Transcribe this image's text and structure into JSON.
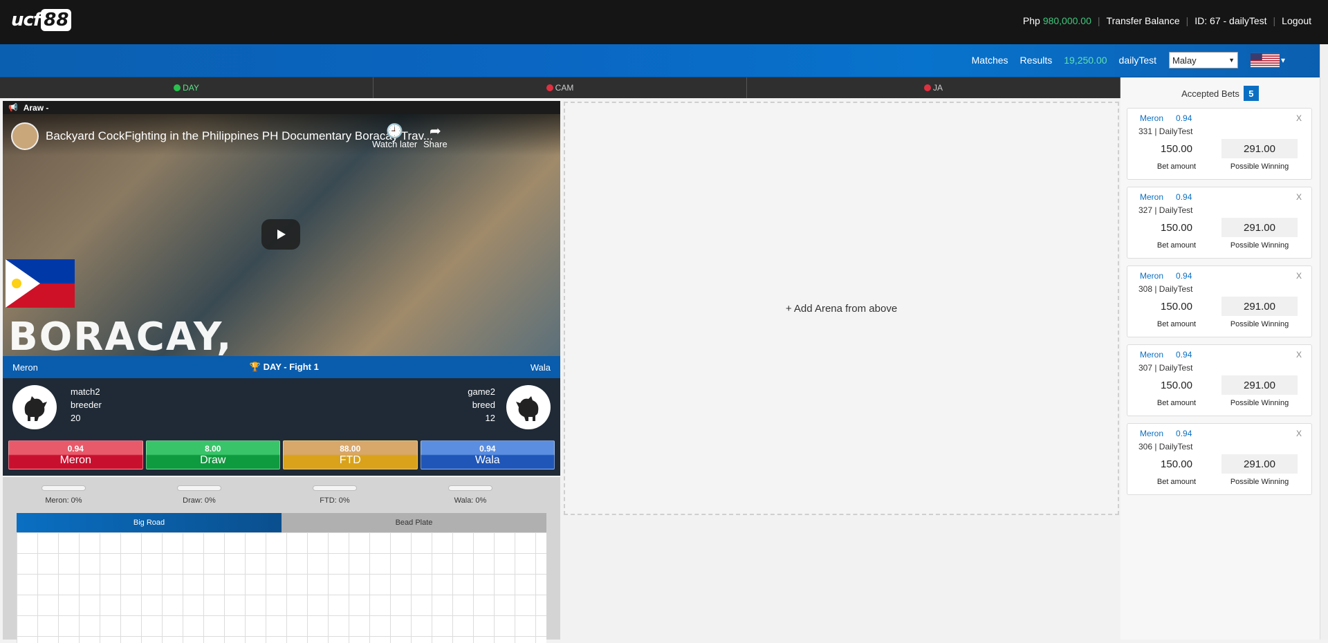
{
  "brand": {
    "logo_left": "ucf",
    "logo_right": "88"
  },
  "account": {
    "currency": "Php",
    "balance": "980,000.00",
    "transfer_label": "Transfer Balance",
    "id_label": "ID: 67 - dailyTest",
    "logout_label": "Logout"
  },
  "subnav": {
    "matches": "Matches",
    "results": "Results",
    "balance": "19,250.00",
    "username": "dailyTest",
    "language": "Malay",
    "language_arrow": "▼",
    "flag_arrow": "▾"
  },
  "tabs": [
    {
      "label": "DAY",
      "dot_color": "#27c24c"
    },
    {
      "label": "CAM",
      "dot_color": "#e03040"
    },
    {
      "label": "JA",
      "dot_color": "#e03040"
    }
  ],
  "arena": {
    "title": "Araw -",
    "video_title": "Backyard CockFighting in the Philippines PH Documentary Boracay Trav...",
    "watch_later": "Watch later",
    "share": "Share",
    "watermark": "BORACAY,",
    "left_label": "Meron",
    "fight_title": "DAY - Fight 1",
    "right_label": "Wala",
    "left_fighter": {
      "name": "match2",
      "breed": "breeder",
      "weight": "20"
    },
    "right_fighter": {
      "name": "game2",
      "breed": "breed",
      "weight": "12"
    }
  },
  "bets": [
    {
      "odd": "0.94",
      "label": "Meron",
      "color_top": "#e85a6a",
      "color_bottom": "#c8102e"
    },
    {
      "odd": "8.00",
      "label": "Draw",
      "color_top": "#39c46a",
      "color_bottom": "#0e9a3e"
    },
    {
      "odd": "88.00",
      "label": "FTD",
      "color_top": "#d8a76a",
      "color_bottom": "#d9a21a"
    },
    {
      "odd": "0.94",
      "label": "Wala",
      "color_top": "#5b8ee0",
      "color_bottom": "#1f56b8"
    }
  ],
  "stats": [
    {
      "label": "Meron: 0%",
      "pct": 0
    },
    {
      "label": "Draw: 0%",
      "pct": 0
    },
    {
      "label": "FTD: 0%",
      "pct": 0
    },
    {
      "label": "Wala: 0%",
      "pct": 0
    }
  ],
  "road_tabs": {
    "big_road": "Big Road",
    "bead_plate": "Bead Plate"
  },
  "add_arena": "+ Add Arena from above",
  "accepted": {
    "title": "Accepted Bets",
    "count": "5",
    "bet_amount_label": "Bet amount",
    "possible_label": "Possible Winning",
    "items": [
      {
        "side": "Meron",
        "odd": "0.94",
        "ref": "331 | DailyTest",
        "amount": "150.00",
        "win": "291.00"
      },
      {
        "side": "Meron",
        "odd": "0.94",
        "ref": "327 | DailyTest",
        "amount": "150.00",
        "win": "291.00"
      },
      {
        "side": "Meron",
        "odd": "0.94",
        "ref": "308 | DailyTest",
        "amount": "150.00",
        "win": "291.00"
      },
      {
        "side": "Meron",
        "odd": "0.94",
        "ref": "307 | DailyTest",
        "amount": "150.00",
        "win": "291.00"
      },
      {
        "side": "Meron",
        "odd": "0.94",
        "ref": "306 | DailyTest",
        "amount": "150.00",
        "win": "291.00"
      }
    ]
  }
}
